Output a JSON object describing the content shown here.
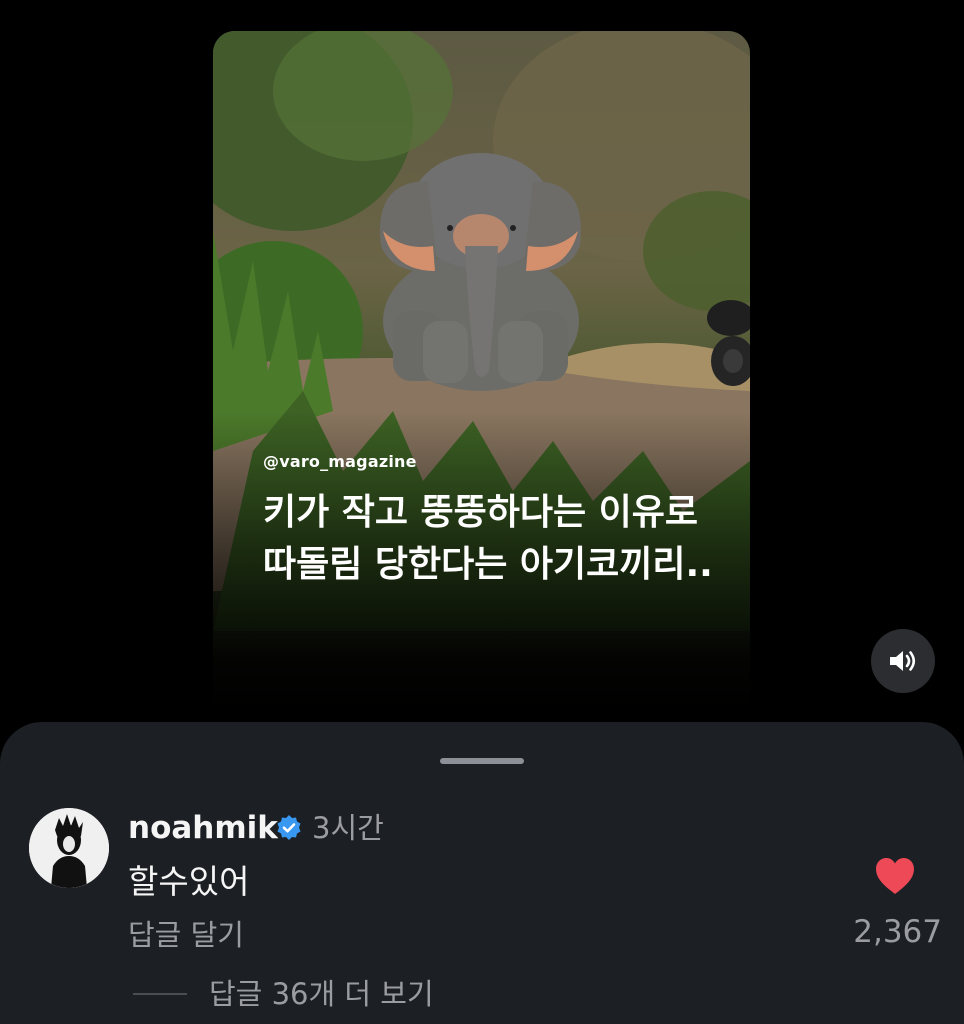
{
  "post": {
    "watermark": "@varo_magazine",
    "caption_lines": [
      "키가 작고 뚱뚱하다는 이유로",
      "따돌림 당한다는 아기코끼리.."
    ],
    "sound_icon": "speaker-volume-icon"
  },
  "comments_sheet": {
    "comment": {
      "username": "noahmik",
      "verified_icon": "verified-badge-icon",
      "time": "3시간",
      "text": "할수있어",
      "reply_label": "답글 달기",
      "like_icon": "heart-filled-icon",
      "like_color": "#ed4956",
      "like_count": "2,367",
      "more_replies_label": "답글 36개 더 보기"
    }
  },
  "colors": {
    "background": "#000000",
    "sheet": "#1c1f24",
    "secondary_text": "#9a9ca1",
    "verified": "#3897f0"
  }
}
